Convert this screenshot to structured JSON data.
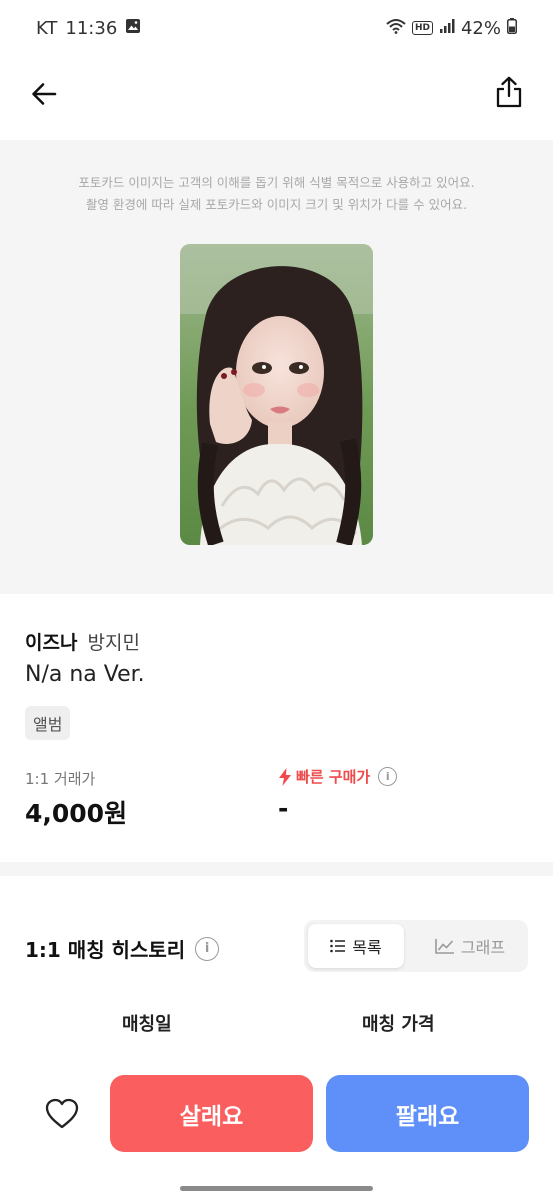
{
  "status_bar": {
    "carrier": "KT",
    "time": "11:36",
    "hd": "HD",
    "battery": "42%"
  },
  "image_section": {
    "notice_line1": "포토카드 이미지는 고객의 이해를 돕기 위해 식별 목적으로 사용하고 있어요.",
    "notice_line2": "촬영 환경에 따라 실제 포토카드와 이미지 크기 및 위치가 다를 수 있어요."
  },
  "product": {
    "artist": "이즈나",
    "member": "방지민",
    "version": "N/a na Ver.",
    "tag": "앨범",
    "price_label": "1:1 거래가",
    "price_value": "4,000원",
    "fast_label": "빠른 구매가",
    "fast_value": "-"
  },
  "history": {
    "title": "1:1 매칭 히스토리",
    "tab_list": "목록",
    "tab_graph": "그래프",
    "col_date": "매칭일",
    "col_price": "매칭 가격"
  },
  "actions": {
    "buy": "살래요",
    "sell": "팔래요"
  },
  "colors": {
    "buy": "#fb5e5e",
    "sell": "#5f8ff8",
    "fast": "#ef4b4b"
  }
}
